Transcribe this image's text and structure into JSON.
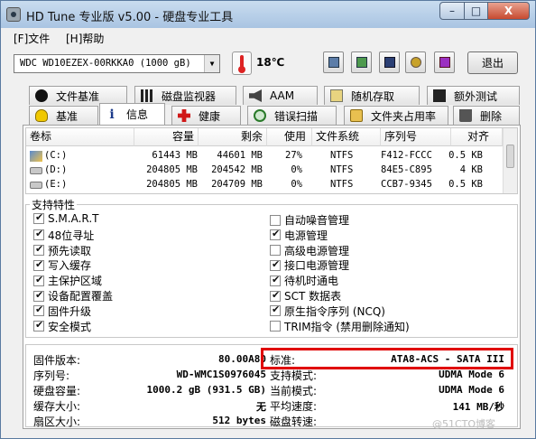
{
  "window": {
    "title": "HD Tune 专业版 v5.00 - 硬盘专业工具",
    "min_label": "–",
    "max_label": "□",
    "close_label": "X"
  },
  "menu": [
    "[F]文件",
    "[H]帮助"
  ],
  "toolbar": {
    "drive": "WDC WD10EZEX-00RKKA0 (1000 gB)",
    "temperature": "18℃",
    "exit_label": "退出"
  },
  "tabs_top": [
    "文件基准",
    "磁盘监视器",
    "AAM",
    "随机存取",
    "额外测试"
  ],
  "tabs_bottom": [
    "基准",
    "信息",
    "健康",
    "错误扫描",
    "文件夹占用率",
    "删除"
  ],
  "active_tab": "信息",
  "volume_table": {
    "columns": [
      "卷标",
      "容量",
      "剩余",
      "使用",
      "文件系统",
      "序列号",
      "对齐"
    ],
    "rows": [
      [
        "(C:)",
        "61443 MB",
        "44601 MB",
        "27%",
        "NTFS",
        "F412-FCCC",
        "0.5 KB"
      ],
      [
        "(D:)",
        "204805 MB",
        "204542 MB",
        "0%",
        "NTFS",
        "84E5-C895",
        "4 KB"
      ],
      [
        "(E:)",
        "204805 MB",
        "204709 MB",
        "0%",
        "NTFS",
        "CCB7-9345",
        "0.5 KB"
      ]
    ]
  },
  "features": {
    "label": "支持特性",
    "left": [
      {
        "label": "S.M.A.R.T",
        "checked": true
      },
      {
        "label": "48位寻址",
        "checked": true
      },
      {
        "label": "预先读取",
        "checked": true
      },
      {
        "label": "写入缓存",
        "checked": true
      },
      {
        "label": "主保护区域",
        "checked": true
      },
      {
        "label": "设备配置覆盖",
        "checked": true
      },
      {
        "label": "固件升级",
        "checked": true
      },
      {
        "label": "安全模式",
        "checked": true
      }
    ],
    "right": [
      {
        "label": "自动噪音管理",
        "checked": false
      },
      {
        "label": "电源管理",
        "checked": true
      },
      {
        "label": "高级电源管理",
        "checked": false
      },
      {
        "label": "接口电源管理",
        "checked": true
      },
      {
        "label": "待机时通电",
        "checked": true
      },
      {
        "label": "SCT 数据表",
        "checked": true
      },
      {
        "label": "原生指令序列 (NCQ)",
        "checked": true
      },
      {
        "label": "TRIM指令 (禁用删除通知)",
        "checked": false
      }
    ]
  },
  "info": {
    "left": [
      {
        "label": "固件版本:",
        "value": "80.00A80"
      },
      {
        "label": "序列号:",
        "value": "WD-WMC1S0976045"
      },
      {
        "label": "硬盘容量:",
        "value": "1000.2 gB (931.5 GB)"
      },
      {
        "label": "缓存大小:",
        "value": "无"
      },
      {
        "label": "扇区大小:",
        "value": "512 bytes"
      }
    ],
    "right": [
      {
        "label": "标准:",
        "value": "ATA8-ACS - SATA III"
      },
      {
        "label": "支持模式:",
        "value": "UDMA Mode 6"
      },
      {
        "label": "当前模式:",
        "value": "UDMA Mode 6"
      },
      {
        "label": "平均速度:",
        "value": "141 MB/秒"
      },
      {
        "label": "磁盘转速:",
        "value": ""
      }
    ]
  },
  "watermark": "@51CTO博客"
}
